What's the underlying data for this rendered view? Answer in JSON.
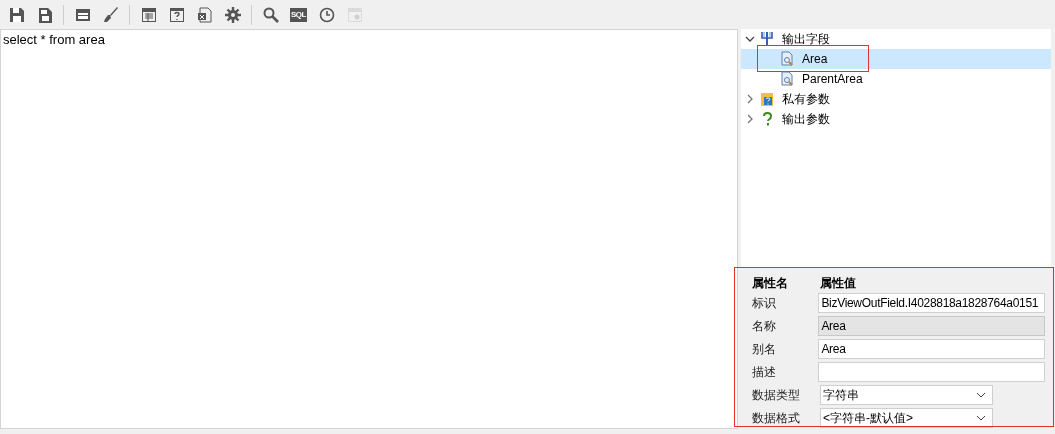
{
  "toolbar": {
    "buttons": [
      {
        "kind": "save",
        "disabled": false
      },
      {
        "kind": "save-as",
        "disabled": false
      },
      {
        "kind": "sep"
      },
      {
        "kind": "window",
        "disabled": false
      },
      {
        "kind": "brush",
        "disabled": false
      },
      {
        "kind": "sep"
      },
      {
        "kind": "table",
        "disabled": false
      },
      {
        "kind": "question",
        "disabled": false
      },
      {
        "kind": "excel",
        "disabled": false
      },
      {
        "kind": "gear",
        "disabled": false
      },
      {
        "kind": "sep"
      },
      {
        "kind": "search",
        "disabled": false
      },
      {
        "kind": "sql",
        "label": "SQL",
        "disabled": false
      },
      {
        "kind": "clock",
        "disabled": false
      },
      {
        "kind": "preview",
        "disabled": true
      }
    ]
  },
  "editor": {
    "value": "select * from area"
  },
  "tree": {
    "items": [
      {
        "kind": "fields",
        "label": "输出字段",
        "expanded": true,
        "selected": false,
        "children": [
          {
            "kind": "field",
            "label": "Area",
            "selected": true,
            "highlighted": true
          },
          {
            "kind": "field",
            "label": "ParentArea",
            "selected": false,
            "highlighted": false
          }
        ]
      },
      {
        "kind": "private",
        "label": "私有参数",
        "expanded": false,
        "selected": false
      },
      {
        "kind": "output",
        "label": "输出参数",
        "expanded": false,
        "selected": false
      }
    ]
  },
  "properties": {
    "highlighted": true,
    "columns": [
      "属性名",
      "属性值"
    ],
    "rows": [
      {
        "name": "标识",
        "kind": "text",
        "value": "BizViewOutField.I4028818a1828764a0151",
        "disabled": false
      },
      {
        "name": "名称",
        "kind": "text",
        "value": "Area",
        "disabled": true
      },
      {
        "name": "别名",
        "kind": "text",
        "value": "Area",
        "disabled": false
      },
      {
        "name": "描述",
        "kind": "text",
        "disabled": false
      },
      {
        "name": "数据类型",
        "kind": "select",
        "value": "字符串"
      },
      {
        "name": "数据格式",
        "kind": "select",
        "value": "<字符串-默认值>"
      }
    ]
  }
}
